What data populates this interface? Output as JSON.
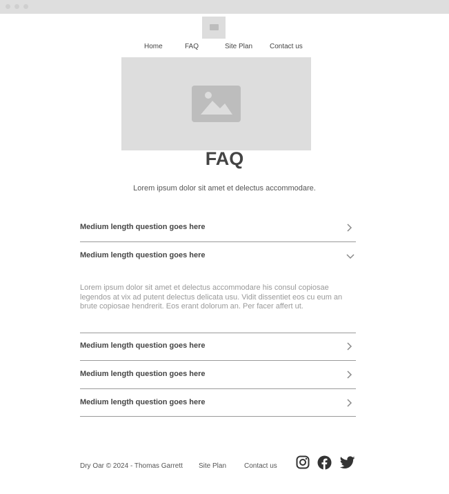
{
  "window": {
    "controls": [
      "close",
      "minimize",
      "maximize"
    ]
  },
  "header": {
    "logo_icon": "image-placeholder-icon",
    "nav": [
      "Home",
      "FAQ",
      "Site Plan",
      "Contact us"
    ]
  },
  "hero": {
    "icon": "image-placeholder-icon"
  },
  "page": {
    "title": "FAQ",
    "intro": "Lorem ipsum dolor sit amet et delectus accommodare."
  },
  "faq": {
    "items": [
      {
        "question": "Medium length question goes here",
        "expanded": false
      },
      {
        "question": "Medium length question goes here",
        "expanded": true,
        "answer": "Lorem ipsum dolor sit amet et delectus accommodare his consul copiosae legendos at vix ad putent delectus delicata usu. Vidit dissentiet eos cu eum an brute copiosae hendrerit. Eos erant dolorum an. Per facer affert ut."
      },
      {
        "question": "Medium length question goes here",
        "expanded": false
      },
      {
        "question": "Medium length question goes here",
        "expanded": false
      },
      {
        "question": "Medium length question goes here",
        "expanded": false
      }
    ]
  },
  "footer": {
    "copyright": "Dry Oar © 2024 - Thomas Garrett",
    "links": [
      "Site Plan",
      "Contact us"
    ],
    "social": [
      "instagram-icon",
      "facebook-icon",
      "twitter-icon"
    ]
  },
  "colors": {
    "placeholder": "#dddddd",
    "text": "#444444",
    "muted": "#999999"
  }
}
